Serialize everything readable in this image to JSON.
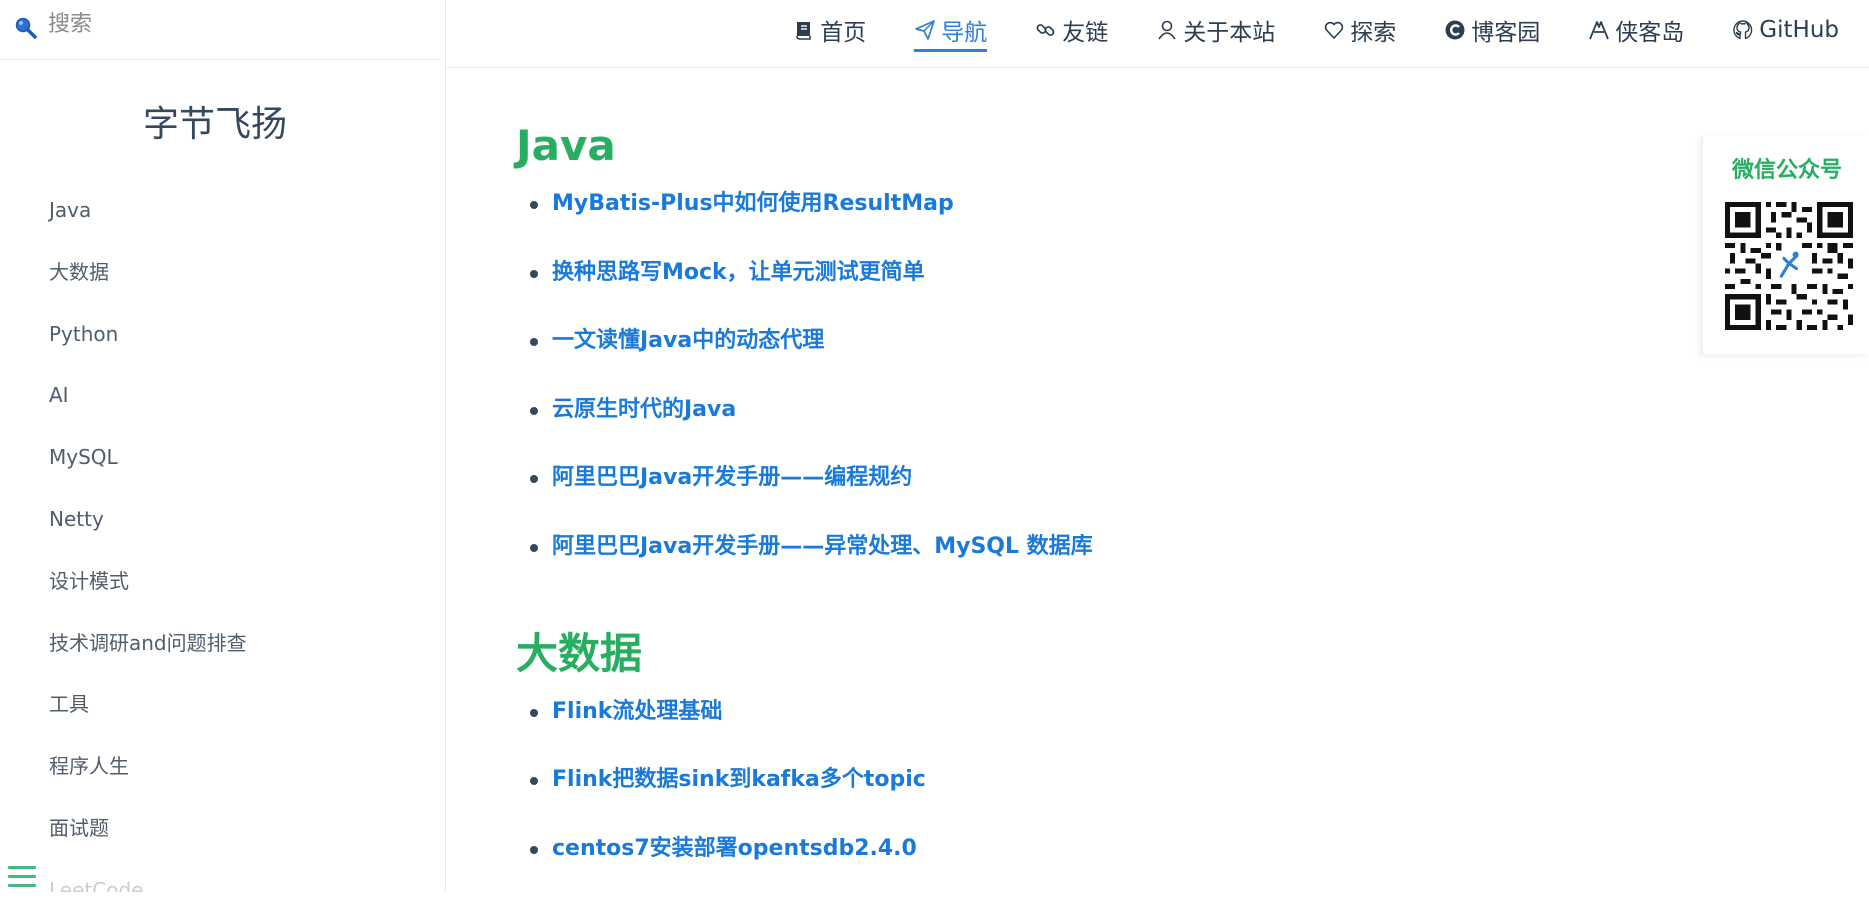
{
  "search": {
    "placeholder": "搜索"
  },
  "sidebar": {
    "app_name": "字节飞扬",
    "items": [
      {
        "label": "Java"
      },
      {
        "label": "大数据"
      },
      {
        "label": "Python"
      },
      {
        "label": "AI"
      },
      {
        "label": "MySQL"
      },
      {
        "label": "Netty"
      },
      {
        "label": "设计模式"
      },
      {
        "label": "技术调研and问题排查"
      },
      {
        "label": "工具"
      },
      {
        "label": "程序人生"
      },
      {
        "label": "面试题"
      },
      {
        "label": "LeetCode"
      }
    ]
  },
  "top_nav": {
    "items": [
      {
        "label": "首页",
        "icon": "book-icon"
      },
      {
        "label": "导航",
        "icon": "paper-plane-icon",
        "active": true
      },
      {
        "label": "友链",
        "icon": "link-icon"
      },
      {
        "label": "关于本站",
        "icon": "user-icon"
      },
      {
        "label": "探索",
        "icon": "heart-icon"
      },
      {
        "label": "博客园",
        "icon": "cnblogs-icon"
      },
      {
        "label": "侠客岛",
        "icon": "xiakedao-icon"
      },
      {
        "label": "GitHub",
        "icon": "github-icon"
      }
    ],
    "active_color": "#2f7fd6"
  },
  "main": {
    "sections": [
      {
        "title": "Java",
        "articles": [
          {
            "title": "MyBatis-Plus中如何使用ResultMap"
          },
          {
            "title": "换种思路写Mock，让单元测试更简单"
          },
          {
            "title": "一文读懂Java中的动态代理"
          },
          {
            "title": "云原生时代的Java"
          },
          {
            "title": "阿里巴巴Java开发手册——编程规约"
          },
          {
            "title": "阿里巴巴Java开发手册——异常处理、MySQL 数据库"
          }
        ]
      },
      {
        "title": "大数据",
        "articles": [
          {
            "title": "Flink流处理基础"
          },
          {
            "title": "Flink把数据sink到kafka多个topic"
          },
          {
            "title": "centos7安装部署opentsdb2.4.0"
          }
        ]
      }
    ]
  },
  "qr_widget": {
    "title": "微信公众号"
  },
  "colors": {
    "accent_green": "#27ae60",
    "link_blue": "#1a7ad9",
    "text": "#34495e"
  }
}
